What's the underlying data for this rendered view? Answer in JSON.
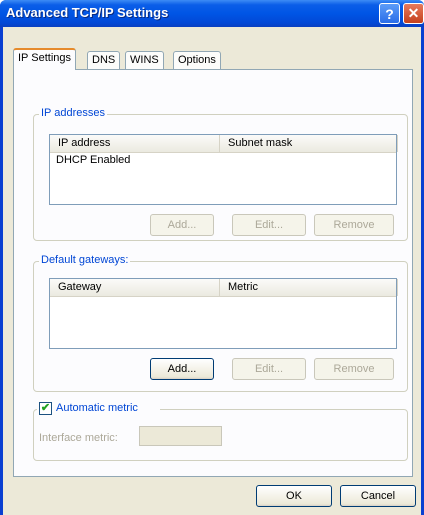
{
  "window": {
    "title": "Advanced TCP/IP Settings"
  },
  "titlebar": {
    "help_glyph": "?",
    "close_glyph": "✕"
  },
  "tabs": [
    {
      "label": "IP Settings",
      "active": true
    },
    {
      "label": "DNS",
      "active": false
    },
    {
      "label": "WINS",
      "active": false
    },
    {
      "label": "Options",
      "active": false
    }
  ],
  "ip_addresses": {
    "group_label": "IP addresses",
    "columns": [
      "IP address",
      "Subnet mask"
    ],
    "rows": [
      "DHCP Enabled"
    ],
    "add_label": "Add...",
    "edit_label": "Edit...",
    "remove_label": "Remove"
  },
  "default_gateways": {
    "group_label": "Default gateways:",
    "columns": [
      "Gateway",
      "Metric"
    ],
    "rows": [],
    "add_label": "Add...",
    "edit_label": "Edit...",
    "remove_label": "Remove"
  },
  "metric": {
    "checkbox_label": "Automatic metric",
    "checked": true,
    "check_glyph": "✔",
    "interface_metric_label": "Interface metric:",
    "interface_metric_value": ""
  },
  "footer": {
    "ok_label": "OK",
    "cancel_label": "Cancel"
  }
}
